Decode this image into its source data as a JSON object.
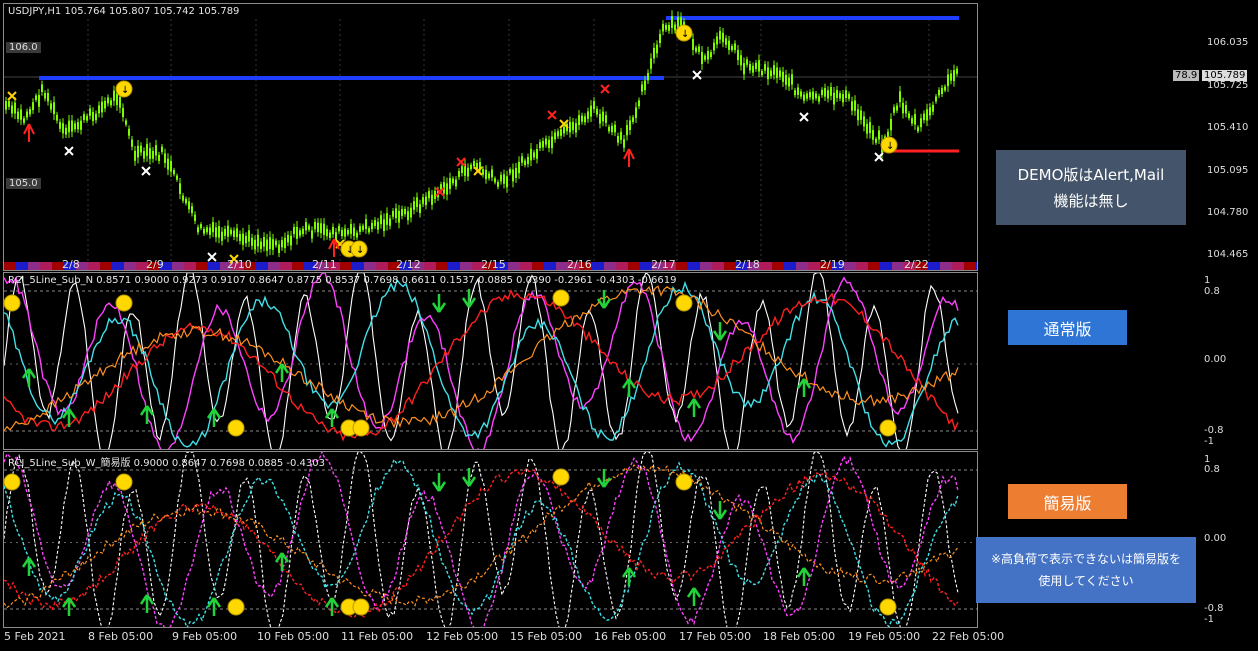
{
  "main_pane": {
    "title": "USDJPY,H1  105.764 105.807 105.742 105.789",
    "level_labels": [
      "106.0",
      "105.0"
    ],
    "day_labels": [
      "2/8",
      "2/9",
      "2/10",
      "2/11",
      "2/12",
      "2/15",
      "2/16",
      "2/17",
      "2/18",
      "2/19",
      "2/22"
    ],
    "price_scale": [
      "106.035",
      "105.725",
      "105.410",
      "105.095",
      "104.780",
      "104.465"
    ],
    "current_price": "105.789",
    "current_price_marker": "78.9",
    "demo_note_line1": "DEMO版はAlert,Mail",
    "demo_note_line2": "機能は無し"
  },
  "sub_pane_1": {
    "title": "RCI_5Line_Sub_N 0.8571 0.9000 0.9273 0.9107 0.8647 0.8775 0.8537 0.7698 0.6611 0.1537 0.0885 0.0390 -0.2961 -0.4303 -0.6619",
    "scale": [
      "1",
      "0.8",
      "0.00",
      "-0.8",
      "-1"
    ],
    "label": "通常版"
  },
  "sub_pane_2": {
    "title": "RCI_5Line_Sub_W_簡易版 0.9000 0.8647 0.7698 0.0885 -0.4303",
    "scale": [
      "1",
      "0.8",
      "0.00",
      "-0.8",
      "-1"
    ],
    "label": "簡易版",
    "note": "※高負荷で表示できないは簡易版を使用してください"
  },
  "time_axis": [
    "5 Feb 2021",
    "8 Feb 05:00",
    "9 Feb 05:00",
    "10 Feb 05:00",
    "11 Feb 05:00",
    "12 Feb 05:00",
    "15 Feb 05:00",
    "16 Feb 05:00",
    "17 Feb 05:00",
    "18 Feb 05:00",
    "19 Feb 05:00",
    "22 Feb 05:00"
  ],
  "colors": {
    "candle": "#7cfc00",
    "resistance_line": "#1f3dff",
    "support_line": "#ff2020",
    "box_demo": "#44546a",
    "box_normal": "#2e75d6",
    "box_simple": "#ed7d31",
    "box_note": "#4472c4"
  }
}
